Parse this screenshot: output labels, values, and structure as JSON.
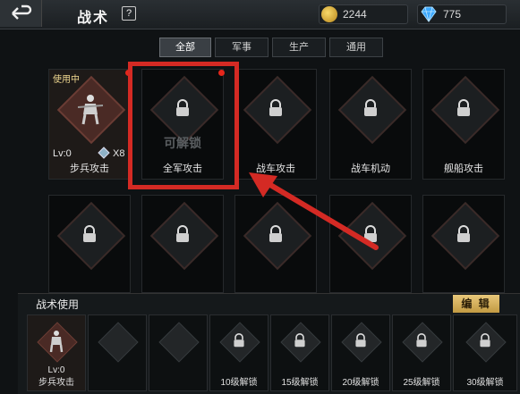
{
  "header": {
    "title": "战术",
    "help": "?",
    "gold": "2244",
    "gems": "775"
  },
  "tabs": [
    {
      "label": "全部",
      "active": true
    },
    {
      "label": "军事",
      "active": false
    },
    {
      "label": "生产",
      "active": false
    },
    {
      "label": "通用",
      "active": false
    }
  ],
  "cards_row1": [
    {
      "label": "步兵攻击",
      "badge": "使用中",
      "level": "Lv:0",
      "count": "X8",
      "unlocked": true
    },
    {
      "label": "全军攻击",
      "overlay": "可解锁",
      "locked": true
    },
    {
      "label": "战车攻击",
      "locked": true
    },
    {
      "label": "战车机动",
      "locked": true
    },
    {
      "label": "舰船攻击",
      "locked": true
    }
  ],
  "usage": {
    "title": "战术使用",
    "edit_label": "编 辑",
    "slots": [
      {
        "label": "步兵攻击",
        "level": "Lv:0"
      },
      {
        "label": ""
      },
      {
        "label": ""
      },
      {
        "label": "10级解锁"
      },
      {
        "label": "15级解锁"
      },
      {
        "label": "20级解锁"
      },
      {
        "label": "25级解锁"
      },
      {
        "label": "30级解锁"
      }
    ]
  },
  "colors": {
    "highlight": "#d42a24",
    "edit_button": "#c29a42",
    "alert_dot": "#e5261b"
  }
}
